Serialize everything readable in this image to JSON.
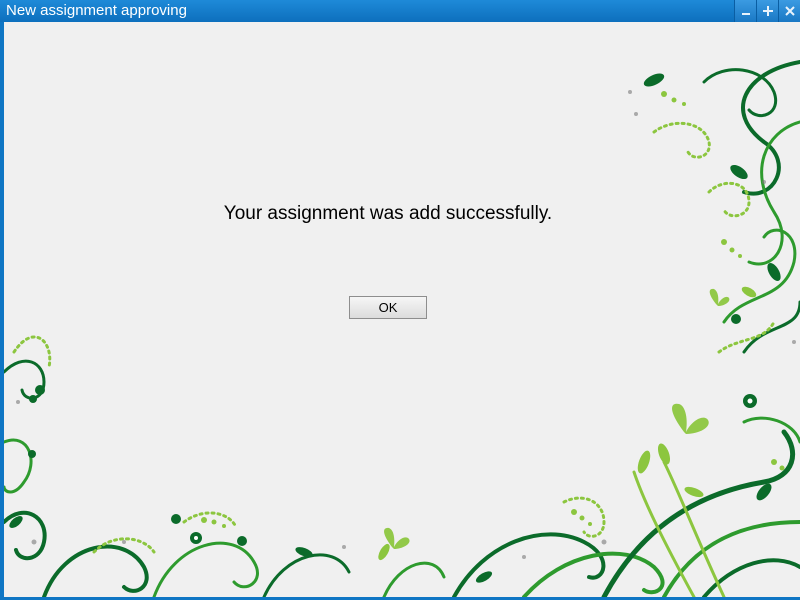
{
  "window": {
    "title": "New assignment approving",
    "minimize_icon": "minimize-icon",
    "maximize_icon": "maximize-icon",
    "close_icon": "close-icon"
  },
  "dialog": {
    "message": "Your assignment was add successfully.",
    "ok_label": "OK"
  },
  "colors": {
    "titlebar": "#1178c6",
    "background": "#f0f0f0",
    "vine_dark": "#0b6b2a",
    "vine_mid": "#2e9b2e",
    "vine_light": "#8cc63f"
  }
}
